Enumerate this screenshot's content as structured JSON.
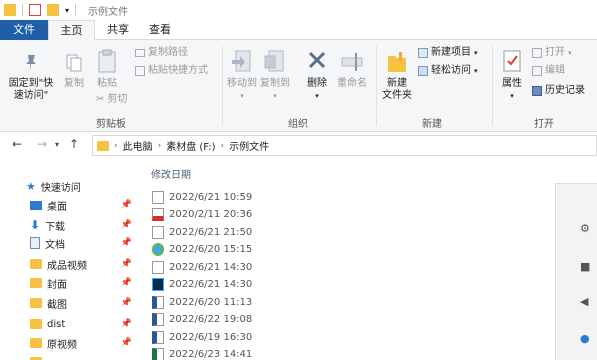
{
  "window": {
    "title": "示例文件"
  },
  "tabs": {
    "file": "文件",
    "home": "主页",
    "share": "共享",
    "view": "查看"
  },
  "ribbon": {
    "clipboard": {
      "pin_label_1": "固定到\"快",
      "pin_label_2": "速访问\"",
      "copy": "复制",
      "paste": "粘贴",
      "copy_path": "复制路径",
      "paste_shortcut": "粘贴快捷方式",
      "cut": "剪切",
      "group": "剪贴板"
    },
    "organize": {
      "move_to": "移动到",
      "copy_to": "复制到",
      "delete": "删除",
      "rename": "重命名",
      "group": "组织"
    },
    "new": {
      "new_folder_1": "新建",
      "new_folder_2": "文件夹",
      "new_item": "新建项目",
      "easy_access": "轻松访问",
      "group": "新建"
    },
    "open": {
      "properties": "属性",
      "open": "打开",
      "edit": "编辑",
      "history": "历史记录",
      "group": "打开"
    }
  },
  "address": {
    "crumbs": [
      "此电脑",
      "素材盘 (F:)",
      "示例文件"
    ]
  },
  "nav": {
    "quick_access": "快速访问",
    "items": [
      {
        "label": "桌面",
        "icon": "desktop-icon",
        "pinned": true
      },
      {
        "label": "下载",
        "icon": "download-icon",
        "pinned": true
      },
      {
        "label": "文档",
        "icon": "document-icon",
        "pinned": true
      },
      {
        "label": "成品视频",
        "icon": "folder-icon",
        "pinned": true
      },
      {
        "label": "封面",
        "icon": "folder-icon",
        "pinned": true
      },
      {
        "label": "截图",
        "icon": "folder-icon",
        "pinned": true
      },
      {
        "label": "dist",
        "icon": "folder-icon",
        "pinned": true
      },
      {
        "label": "原视频",
        "icon": "folder-icon",
        "pinned": true
      }
    ]
  },
  "files": {
    "header": "修改日期",
    "rows": [
      {
        "date": "2022/6/21 10:59",
        "type": "blank"
      },
      {
        "date": "2020/2/11 20:36",
        "type": "pdf"
      },
      {
        "date": "2022/6/21 21:50",
        "type": "blank"
      },
      {
        "date": "2022/6/20 15:15",
        "type": "image"
      },
      {
        "date": "2022/6/21 14:30",
        "type": "blank"
      },
      {
        "date": "2022/6/21 14:30",
        "type": "ps"
      },
      {
        "date": "2022/6/20 11:13",
        "type": "word"
      },
      {
        "date": "2022/6/22 19:08",
        "type": "word"
      },
      {
        "date": "2022/6/19 16:30",
        "type": "word"
      },
      {
        "date": "2022/6/23 14:41",
        "type": "excel"
      }
    ]
  },
  "colors": {
    "accent": "#1e5fa8",
    "folder": "#f5c242"
  }
}
